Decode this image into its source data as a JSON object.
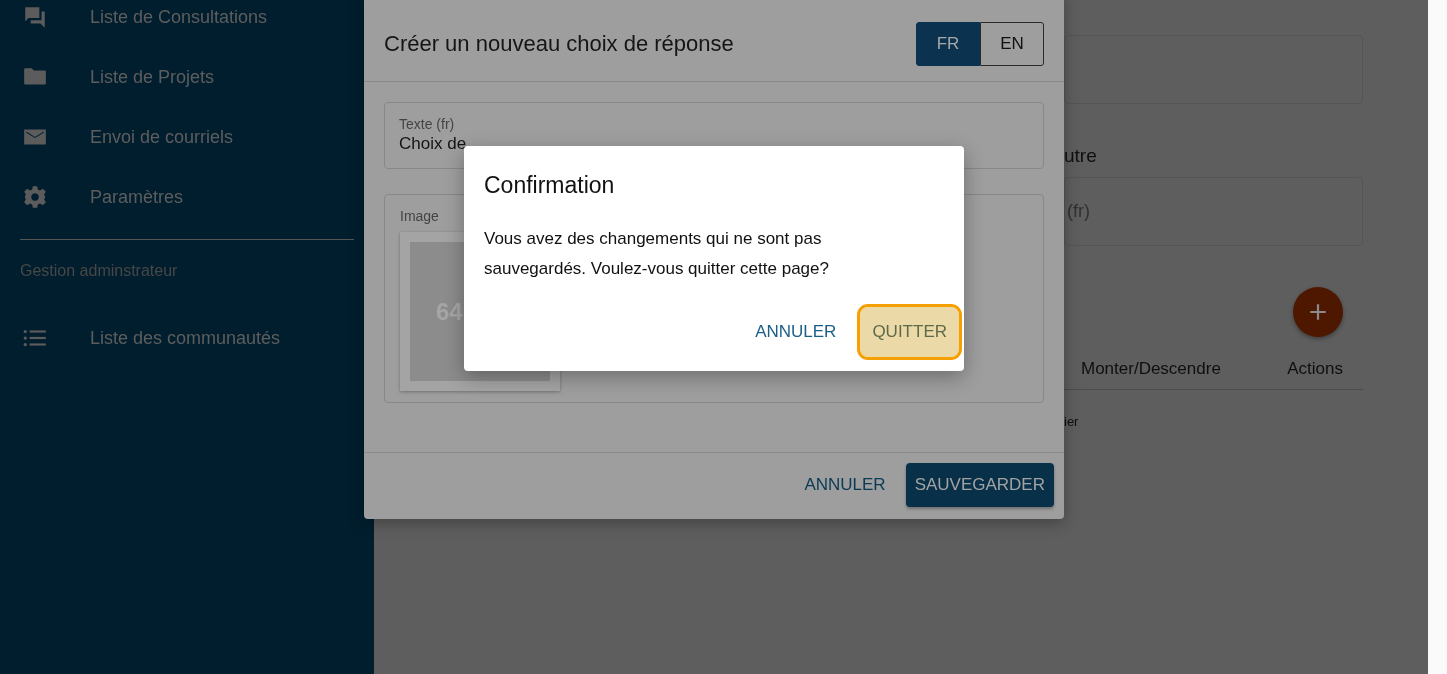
{
  "sidebar": {
    "sections": [
      {
        "items": [
          {
            "label": "Liste de Consultations"
          },
          {
            "label": "Liste de Projets"
          },
          {
            "label": "Envoi de courriels"
          },
          {
            "label": "Paramètres"
          }
        ]
      },
      {
        "heading": "Gestion adminstrateur",
        "items": [
          {
            "label": "Liste des communautés"
          }
        ]
      }
    ]
  },
  "background_page": {
    "section_title": "utre",
    "field_placeholder": "(fr)",
    "table": {
      "columns": [
        "Monter/Descendre",
        "Actions"
      ],
      "row_text": "ier"
    }
  },
  "editor_dialog": {
    "title": "Créer un nouveau choix de réponse",
    "languages": [
      {
        "label": "FR",
        "selected": true
      },
      {
        "label": "EN",
        "selected": false
      }
    ],
    "text_field": {
      "label": "Texte (fr)",
      "value": "Choix de"
    },
    "image_field": {
      "label": "Image",
      "placeholder_text": "64"
    },
    "buttons": [
      {
        "label": "ANNULER",
        "kind": "text"
      },
      {
        "label": "SAUVEGARDER",
        "kind": "primary"
      }
    ]
  },
  "confirm_dialog": {
    "title": "Confirmation",
    "message": "Vous avez des changements qui ne sont pas sauvegardés. Voulez-vous quitter cette page?",
    "buttons": [
      {
        "label": "ANNULER",
        "kind": "text",
        "focused": false
      },
      {
        "label": "QUITTER",
        "kind": "tonal",
        "focused": true
      }
    ]
  }
}
